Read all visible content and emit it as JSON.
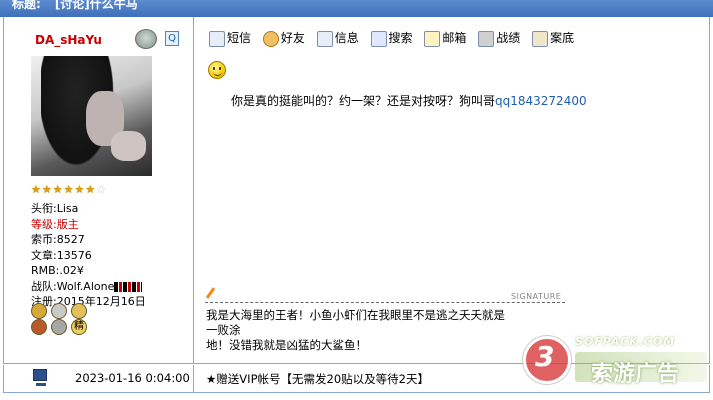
{
  "header": {
    "label": "标题:",
    "title": "[讨论]什么牛马"
  },
  "author": {
    "name": "DA_sHaYu",
    "stars_filled": 6,
    "stars_total": 7,
    "info": [
      {
        "label": "头衔:",
        "value": "Lisa",
        "red": false
      },
      {
        "label": "等级:",
        "value": "版主",
        "red": true
      },
      {
        "label": "索币:",
        "value": "8527",
        "red": false
      },
      {
        "label": "文章:",
        "value": "13576",
        "red": false
      },
      {
        "label": "RMB:",
        "value": ".02¥",
        "red": false
      },
      {
        "label": "战队:",
        "value": "Wolf.Alone",
        "red": false
      },
      {
        "label": "注册:",
        "value": "2015年12月16日",
        "red": false
      }
    ],
    "medal_char": "精"
  },
  "toolbar": [
    {
      "label": "短信",
      "icon": "sms-icon"
    },
    {
      "label": "好友",
      "icon": "friends-icon"
    },
    {
      "label": "信息",
      "icon": "info-icon"
    },
    {
      "label": "搜索",
      "icon": "search-icon"
    },
    {
      "label": "邮箱",
      "icon": "mail-icon"
    },
    {
      "label": "战绩",
      "icon": "record-icon"
    },
    {
      "label": "案底",
      "icon": "case-icon"
    }
  ],
  "post": {
    "text": "你是真的挺能叫的？约一架？还是对按呀？狗叫哥",
    "qq": "qq1843272400",
    "signature_label": "SIGNATURE",
    "signature": [
      "我是大海里的王者！小鱼小虾们在我眼里不是逃之夭夭就是",
      "一败涂",
      "地！没错我就是凶猛的大鲨鱼！"
    ]
  },
  "footer": {
    "time": "2023-01-16 0:04:00",
    "ad": "★赠送VIP帐号【无需发20贴以及等待2天】"
  },
  "watermark": {
    "num": "3",
    "url": "SOFPACK.COM",
    "text": "索游广告"
  }
}
